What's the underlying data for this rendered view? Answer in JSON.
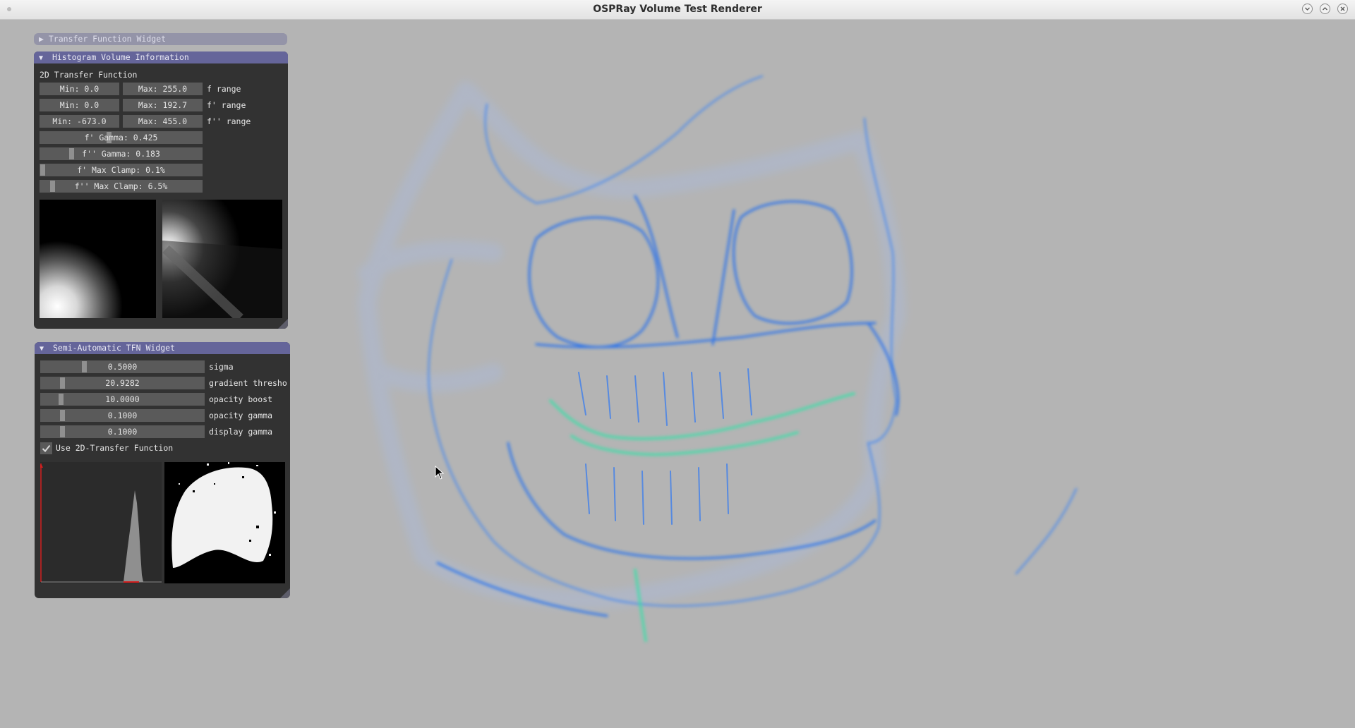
{
  "window": {
    "title": "OSPRay Volume Test Renderer"
  },
  "tfn_widget": {
    "title": "Transfer Function Widget"
  },
  "histogram": {
    "title": "Histogram Volume Information",
    "section": "2D Transfer Function",
    "ranges": [
      {
        "min": "Min: 0.0",
        "max": "Max: 255.0",
        "label": "f    range"
      },
      {
        "min": "Min: 0.0",
        "max": "Max: 192.7",
        "label": "f'  range"
      },
      {
        "min": "Min: -673.0",
        "max": "Max: 455.0",
        "label": "f'' range"
      }
    ],
    "sliders": [
      {
        "text": "f'  Gamma: 0.425",
        "value": 0.425
      },
      {
        "text": "f'' Gamma: 0.183",
        "value": 0.183
      },
      {
        "text": "f'  Max Clamp: 0.1%",
        "value": 0.001
      },
      {
        "text": "f'' Max Clamp: 6.5%",
        "value": 0.065
      }
    ]
  },
  "semi_auto": {
    "title": "Semi-Automatic TFN Widget",
    "params": [
      {
        "value": "0.5000",
        "label": "sigma",
        "level": 0.26
      },
      {
        "value": "20.9282",
        "label": "gradient thresho",
        "level": 0.12
      },
      {
        "value": "10.0000",
        "label": "opacity boost",
        "level": 0.11
      },
      {
        "value": "0.1000",
        "label": "opacity gamma",
        "level": 0.12
      },
      {
        "value": "0.1000",
        "label": "display gamma",
        "level": 0.12
      }
    ],
    "checkbox": {
      "label": "Use 2D-Transfer Function",
      "checked": true
    }
  },
  "colors": {
    "panel_header": "#65659a",
    "volume_blue": "#2e7ef0",
    "volume_green": "#37e0a8",
    "background": "#b4b4b4"
  }
}
